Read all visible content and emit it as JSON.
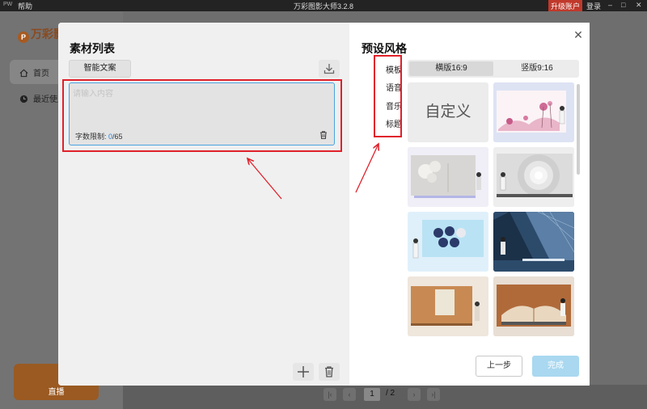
{
  "titlebar": {
    "badge": "PW",
    "help": "帮助",
    "title": "万彩图影大师3.2.8",
    "upgrade": "升级账户",
    "login": "登录",
    "minimize": "–",
    "maximize": "□",
    "close": "✕"
  },
  "background": {
    "logo_text": "万彩影",
    "nav_home": "首页",
    "nav_recent": "最近使用",
    "live_label": "直播",
    "pager": {
      "current": "1",
      "total": "/ 2"
    }
  },
  "left": {
    "title": "素材列表",
    "smart_copy": "智能文案",
    "input_placeholder": "请输入内容",
    "input_value": "",
    "char_limit_label": "字数限制:",
    "char_current": "0",
    "char_max": "/65"
  },
  "right": {
    "title": "预设风格",
    "side_tabs": [
      "模板",
      "语音",
      "音乐",
      "标题"
    ],
    "seg_landscape": "横版16:9",
    "seg_portrait": "竖版9:16",
    "custom_label": "自定义",
    "prev_button": "上一步",
    "done_button": "完成"
  },
  "colors": {
    "annotation_red": "#e0202a",
    "accent_blue": "#4aa3e0",
    "done_button": "#a9d8f0",
    "upgrade_red": "#c0392b"
  }
}
